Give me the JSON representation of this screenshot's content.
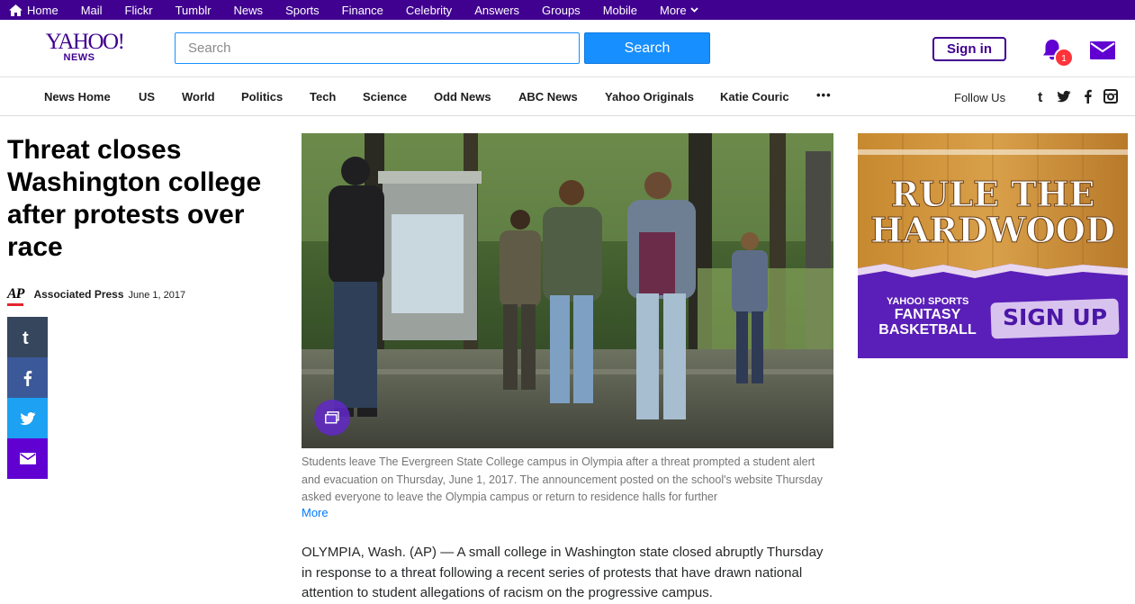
{
  "topbar": {
    "items": [
      "Home",
      "Mail",
      "Flickr",
      "Tumblr",
      "News",
      "Sports",
      "Finance",
      "Celebrity",
      "Answers",
      "Groups",
      "Mobile",
      "More"
    ]
  },
  "header": {
    "logo_line1": "YAHOO!",
    "logo_line2": "NEWS",
    "search_placeholder": "Search",
    "search_button": "Search",
    "sign_in": "Sign in",
    "notification_count": "1"
  },
  "subnav": {
    "items": [
      "News Home",
      "US",
      "World",
      "Politics",
      "Tech",
      "Science",
      "Odd News",
      "ABC News",
      "Yahoo Originals",
      "Katie Couric"
    ],
    "more_label": "•••",
    "follow_label": "Follow Us"
  },
  "article": {
    "headline": "Threat closes Washington college after protests over race",
    "source_logo": "AP",
    "author": "Associated Press",
    "date": "June 1, 2017",
    "caption": "Students leave The Evergreen State College campus in Olympia after a threat prompted a student alert and evacuation on Thursday, June 1, 2017. The announcement posted on the school's website Thursday asked everyone to leave the Olympia campus or return to residence halls for further",
    "more_label": "More",
    "body": "OLYMPIA, Wash. (AP) — A small college in Washington state closed abruptly Thursday in response to a threat following a recent series of protests that have drawn national attention to student allegations of racism on the progressive campus."
  },
  "ad": {
    "headline_line1": "RULE THE",
    "headline_line2": "HARDWOOD",
    "brand": "YAHOO! SPORTS",
    "product_line1": "FANTASY",
    "product_line2": "BASKETBALL",
    "cta": "SIGN UP"
  },
  "colors": {
    "brand_purple": "#400090",
    "search_blue": "#188fff",
    "badge_red": "#ff333a",
    "tumblr": "#36465d",
    "facebook": "#3b5998",
    "twitter": "#1da1f2",
    "mail": "#6001d2"
  }
}
